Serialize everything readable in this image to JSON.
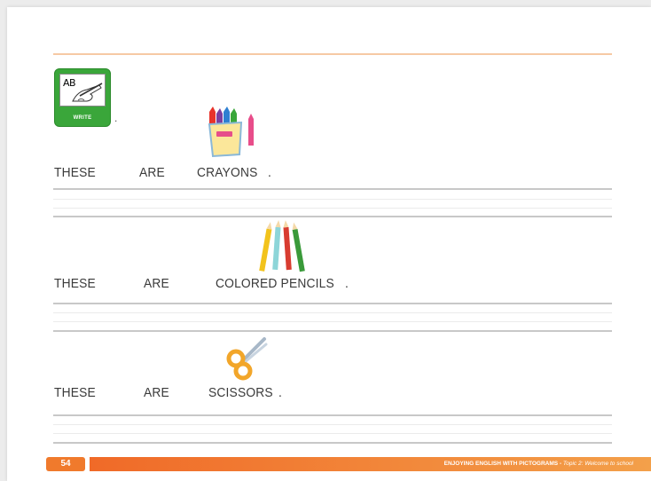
{
  "pictogram": {
    "label": "WRITE",
    "card_text": "AB"
  },
  "badge_dot": ".",
  "rows": [
    {
      "w1": "THESE",
      "w2": "ARE",
      "w3": "CRAYONS",
      "period": "."
    },
    {
      "w1": "THESE",
      "w2": "ARE",
      "w3": "COLORED PENCILS",
      "period": "."
    },
    {
      "w1": "THESE",
      "w2": "ARE",
      "w3": "SCISSORS",
      "period": "."
    }
  ],
  "footer": {
    "page_number": "54",
    "book_title": "ENJOYING ENGLISH WITH PICTOGRAMS",
    "separator": " - ",
    "topic": "Topic 2: Welcome to school"
  },
  "colors": {
    "accent": "#f07a2c",
    "badge_green": "#3aa63a",
    "top_rule": "#f6c9a4"
  }
}
